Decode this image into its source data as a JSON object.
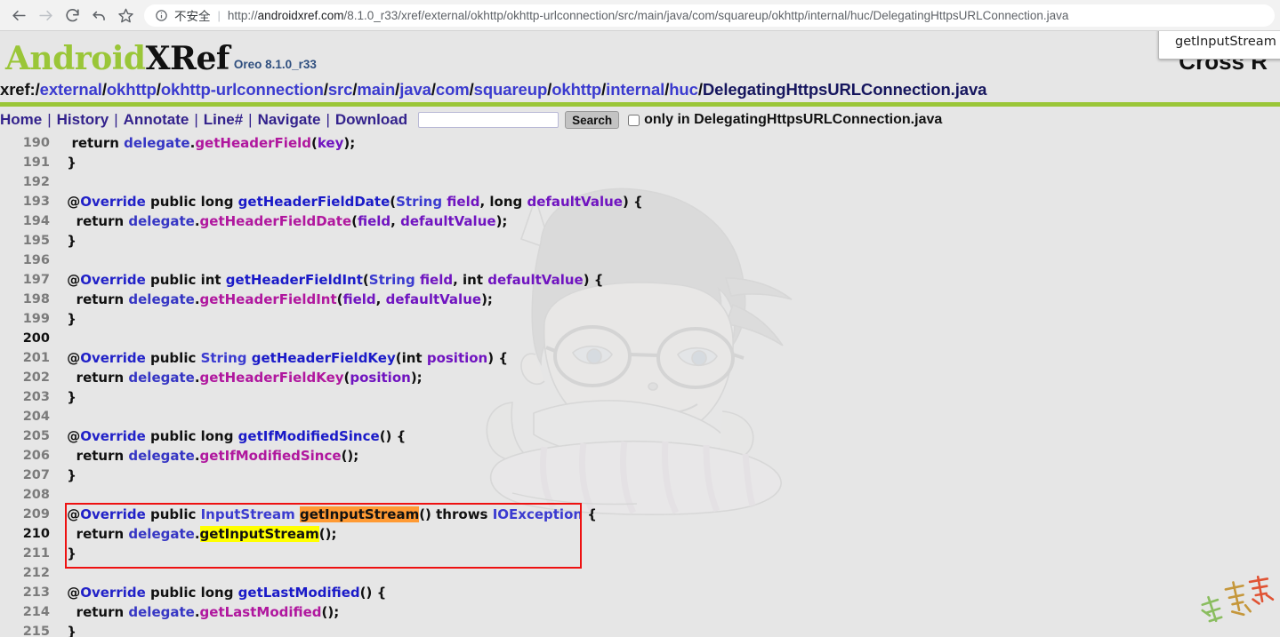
{
  "browser": {
    "back_icon": "back-arrow-icon",
    "forward_icon": "forward-arrow-icon",
    "reload_icon": "reload-icon",
    "undo_icon": "undo-arrow-icon",
    "bookmark_icon": "star-icon",
    "info_icon": "info-circle-icon",
    "security_label": "不安全",
    "separator": "|",
    "url_scheme": "http://",
    "url_host": "androidxref.com",
    "url_path": "/8.1.0_r33/xref/external/okhttp/okhttp-urlconnection/src/main/java/com/squareup/okhttp/internal/huc/DelegatingHttpsURLConnection.java"
  },
  "tooltip": {
    "text": "getInputStream"
  },
  "masthead": {
    "logo_first": "Android",
    "logo_second": "XRef",
    "version": "Oreo 8.1.0_r33",
    "right_title": "Cross R"
  },
  "breadcrumb": {
    "label": "xref:",
    "separator": "/",
    "parts": [
      "external",
      "okhttp",
      "okhttp-urlconnection",
      "src",
      "main",
      "java",
      "com",
      "squareup",
      "okhttp",
      "internal",
      "huc"
    ],
    "current": "DelegatingHttpsURLConnection.java"
  },
  "toolbar": {
    "links": [
      "Home",
      "History",
      "Annotate",
      "Line#",
      "Navigate",
      "Download"
    ],
    "separator": "|",
    "search_value": "",
    "search_placeholder": "",
    "search_button": "Search",
    "only_in_checked": false,
    "only_in_label": "only in DelegatingHttpsURLConnection.java"
  },
  "colors": {
    "brand_green": "#9ac638",
    "link_blue": "#3b3bcf",
    "nav_purple": "#33228c",
    "method_call": "#b0179e",
    "method_def": "#1a1ac8",
    "variable": "#7014c0",
    "highlight_def": "#ff9a34",
    "highlight_ref": "#ffff00",
    "redbox": "#ee1111",
    "page_bg": "#e6e6e6"
  },
  "code": {
    "current_lines": [
      200,
      210
    ],
    "highlight_box_lines": [
      209,
      211
    ],
    "lines": [
      {
        "n": 190,
        "tokens": [
          {
            "t": "  return ",
            "c": "kw"
          },
          {
            "t": "delegate",
            "c": "ident"
          },
          {
            "t": ".",
            "c": "pun"
          },
          {
            "t": "getHeaderField",
            "c": "mcall"
          },
          {
            "t": "(",
            "c": "pun"
          },
          {
            "t": "key",
            "c": "var"
          },
          {
            "t": ");",
            "c": "pun"
          }
        ]
      },
      {
        "n": 191,
        "tokens": [
          {
            "t": " }",
            "c": "pun"
          }
        ]
      },
      {
        "n": 192,
        "tokens": [
          {
            "t": "",
            "c": "pun"
          }
        ]
      },
      {
        "n": 193,
        "tokens": [
          {
            "t": " @",
            "c": "pun"
          },
          {
            "t": "Override",
            "c": "ann"
          },
          {
            "t": " public long ",
            "c": "kw"
          },
          {
            "t": "getHeaderFieldDate",
            "c": "mdef"
          },
          {
            "t": "(",
            "c": "pun"
          },
          {
            "t": "String",
            "c": "type"
          },
          {
            "t": " ",
            "c": "pun"
          },
          {
            "t": "field",
            "c": "var"
          },
          {
            "t": ", long ",
            "c": "kw"
          },
          {
            "t": "defaultValue",
            "c": "var"
          },
          {
            "t": ") {",
            "c": "pun"
          }
        ]
      },
      {
        "n": 194,
        "tokens": [
          {
            "t": "   return ",
            "c": "kw"
          },
          {
            "t": "delegate",
            "c": "ident"
          },
          {
            "t": ".",
            "c": "pun"
          },
          {
            "t": "getHeaderFieldDate",
            "c": "mcall"
          },
          {
            "t": "(",
            "c": "pun"
          },
          {
            "t": "field",
            "c": "var"
          },
          {
            "t": ", ",
            "c": "pun"
          },
          {
            "t": "defaultValue",
            "c": "var"
          },
          {
            "t": ");",
            "c": "pun"
          }
        ]
      },
      {
        "n": 195,
        "tokens": [
          {
            "t": " }",
            "c": "pun"
          }
        ]
      },
      {
        "n": 196,
        "tokens": [
          {
            "t": "",
            "c": "pun"
          }
        ]
      },
      {
        "n": 197,
        "tokens": [
          {
            "t": " @",
            "c": "pun"
          },
          {
            "t": "Override",
            "c": "ann"
          },
          {
            "t": " public int ",
            "c": "kw"
          },
          {
            "t": "getHeaderFieldInt",
            "c": "mdef"
          },
          {
            "t": "(",
            "c": "pun"
          },
          {
            "t": "String",
            "c": "type"
          },
          {
            "t": " ",
            "c": "pun"
          },
          {
            "t": "field",
            "c": "var"
          },
          {
            "t": ", int ",
            "c": "kw"
          },
          {
            "t": "defaultValue",
            "c": "var"
          },
          {
            "t": ") {",
            "c": "pun"
          }
        ]
      },
      {
        "n": 198,
        "tokens": [
          {
            "t": "   return ",
            "c": "kw"
          },
          {
            "t": "delegate",
            "c": "ident"
          },
          {
            "t": ".",
            "c": "pun"
          },
          {
            "t": "getHeaderFieldInt",
            "c": "mcall"
          },
          {
            "t": "(",
            "c": "pun"
          },
          {
            "t": "field",
            "c": "var"
          },
          {
            "t": ", ",
            "c": "pun"
          },
          {
            "t": "defaultValue",
            "c": "var"
          },
          {
            "t": ");",
            "c": "pun"
          }
        ]
      },
      {
        "n": 199,
        "tokens": [
          {
            "t": " }",
            "c": "pun"
          }
        ]
      },
      {
        "n": 200,
        "tokens": [
          {
            "t": "",
            "c": "pun"
          }
        ]
      },
      {
        "n": 201,
        "tokens": [
          {
            "t": " @",
            "c": "pun"
          },
          {
            "t": "Override",
            "c": "ann"
          },
          {
            "t": " public ",
            "c": "kw"
          },
          {
            "t": "String",
            "c": "type"
          },
          {
            "t": " ",
            "c": "pun"
          },
          {
            "t": "getHeaderFieldKey",
            "c": "mdef"
          },
          {
            "t": "(int ",
            "c": "pun"
          },
          {
            "t": "position",
            "c": "var"
          },
          {
            "t": ") {",
            "c": "pun"
          }
        ]
      },
      {
        "n": 202,
        "tokens": [
          {
            "t": "   return ",
            "c": "kw"
          },
          {
            "t": "delegate",
            "c": "ident"
          },
          {
            "t": ".",
            "c": "pun"
          },
          {
            "t": "getHeaderFieldKey",
            "c": "mcall"
          },
          {
            "t": "(",
            "c": "pun"
          },
          {
            "t": "position",
            "c": "var"
          },
          {
            "t": ");",
            "c": "pun"
          }
        ]
      },
      {
        "n": 203,
        "tokens": [
          {
            "t": " }",
            "c": "pun"
          }
        ]
      },
      {
        "n": 204,
        "tokens": [
          {
            "t": "",
            "c": "pun"
          }
        ]
      },
      {
        "n": 205,
        "tokens": [
          {
            "t": " @",
            "c": "pun"
          },
          {
            "t": "Override",
            "c": "ann"
          },
          {
            "t": " public long ",
            "c": "kw"
          },
          {
            "t": "getIfModifiedSince",
            "c": "mdef"
          },
          {
            "t": "() {",
            "c": "pun"
          }
        ]
      },
      {
        "n": 206,
        "tokens": [
          {
            "t": "   return ",
            "c": "kw"
          },
          {
            "t": "delegate",
            "c": "ident"
          },
          {
            "t": ".",
            "c": "pun"
          },
          {
            "t": "getIfModifiedSince",
            "c": "mcall"
          },
          {
            "t": "();",
            "c": "pun"
          }
        ]
      },
      {
        "n": 207,
        "tokens": [
          {
            "t": " }",
            "c": "pun"
          }
        ]
      },
      {
        "n": 208,
        "tokens": [
          {
            "t": "",
            "c": "pun"
          }
        ]
      },
      {
        "n": 209,
        "tokens": [
          {
            "t": " @",
            "c": "pun"
          },
          {
            "t": "Override",
            "c": "ann"
          },
          {
            "t": " public ",
            "c": "kw"
          },
          {
            "t": "InputStream",
            "c": "type"
          },
          {
            "t": " ",
            "c": "pun"
          },
          {
            "t": "getInputStream",
            "c": "kw",
            "hl": "orange"
          },
          {
            "t": "() throws ",
            "c": "kw"
          },
          {
            "t": "IOException",
            "c": "type"
          },
          {
            "t": " {",
            "c": "pun"
          }
        ]
      },
      {
        "n": 210,
        "tokens": [
          {
            "t": "   return ",
            "c": "kw"
          },
          {
            "t": "delegate",
            "c": "ident"
          },
          {
            "t": ".",
            "c": "pun"
          },
          {
            "t": "getInputStream",
            "c": "kw",
            "hl": "yellow"
          },
          {
            "t": "();",
            "c": "pun"
          }
        ]
      },
      {
        "n": 211,
        "tokens": [
          {
            "t": " }",
            "c": "pun"
          }
        ]
      },
      {
        "n": 212,
        "tokens": [
          {
            "t": "",
            "c": "pun"
          }
        ]
      },
      {
        "n": 213,
        "tokens": [
          {
            "t": " @",
            "c": "pun"
          },
          {
            "t": "Override",
            "c": "ann"
          },
          {
            "t": " public long ",
            "c": "kw"
          },
          {
            "t": "getLastModified",
            "c": "mdef"
          },
          {
            "t": "() {",
            "c": "pun"
          }
        ]
      },
      {
        "n": 214,
        "tokens": [
          {
            "t": "   return ",
            "c": "kw"
          },
          {
            "t": "delegate",
            "c": "ident"
          },
          {
            "t": ".",
            "c": "pun"
          },
          {
            "t": "getLastModified",
            "c": "mcall"
          },
          {
            "t": "();",
            "c": "pun"
          }
        ]
      },
      {
        "n": 215,
        "tokens": [
          {
            "t": " }",
            "c": "pun"
          }
        ]
      }
    ]
  }
}
